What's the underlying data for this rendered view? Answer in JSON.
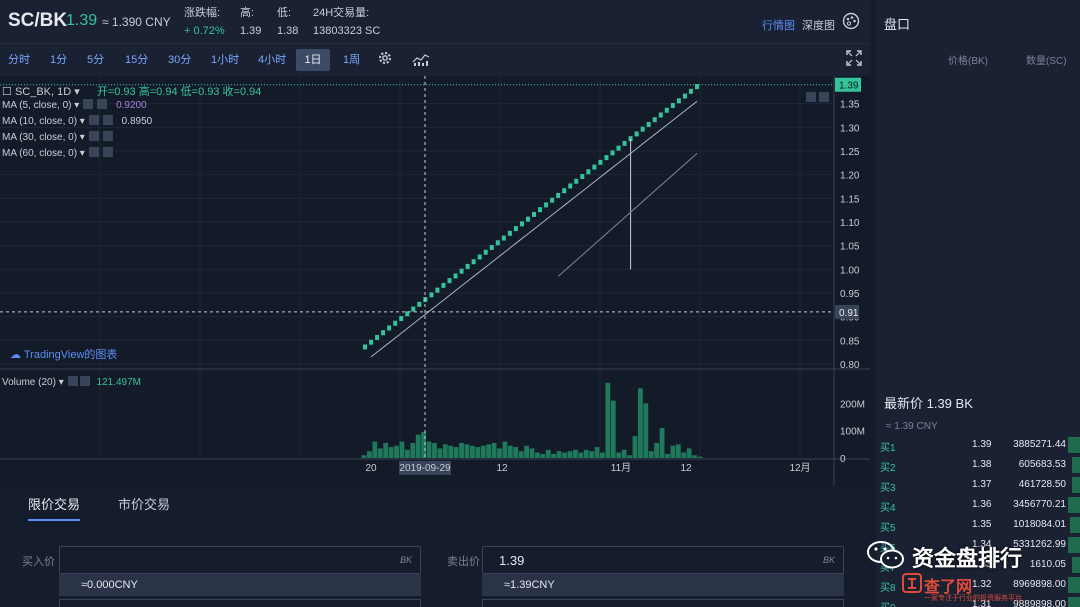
{
  "header": {
    "pair": "SC/BK",
    "price": "1.39",
    "cny": "≈ 1.390 CNY",
    "stats": [
      {
        "key": "涨跌幅:",
        "value": "+ 0.72%"
      },
      {
        "key": "高:",
        "value": "1.39"
      },
      {
        "key": "低:",
        "value": "1.38"
      },
      {
        "key": "24H交易量:",
        "value": "13803323 SC"
      }
    ],
    "tab_line": "行情图",
    "tab_depth": "深度图"
  },
  "toolbar": {
    "timeframes": [
      "分时",
      "1分",
      "5分",
      "15分",
      "30分",
      "1小时",
      "4小时",
      "1日",
      "1周"
    ],
    "active": "1日"
  },
  "chart": {
    "ohlc_symbol": "SC_BK, 1D",
    "ohlc": {
      "open": "开=0.93",
      "high": "高=0.94",
      "low": "低=0.93",
      "close": "收=0.94"
    },
    "ma": [
      {
        "label": "MA (5, close, 0)",
        "value": "0.9200"
      },
      {
        "label": "MA (10, close, 0)",
        "value": "0.8950"
      },
      {
        "label": "MA (30, close, 0)",
        "value": ""
      },
      {
        "label": "MA (60, close, 0)",
        "value": ""
      }
    ],
    "brand": "TradingView的图表",
    "volume_label": "Volume (20)",
    "volume_value": "121.497M",
    "crosshair_x_label": "2019-09-29",
    "crosshair_y_label": "0.91",
    "last_price_tag": "1.39"
  },
  "chart_data": {
    "type": "candlestick",
    "price_axis_ticks": [
      "1.39",
      "1.35",
      "1.30",
      "1.25",
      "1.20",
      "1.15",
      "1.10",
      "1.05",
      "1.00",
      "0.95",
      "0.90",
      "0.85",
      "0.80"
    ],
    "volume_axis_ticks": [
      "200M",
      "100M",
      "0"
    ],
    "x_axis_ticks": [
      "20",
      "2019-09-29",
      "12",
      "11月",
      "12",
      "12月"
    ],
    "closes": [
      0.835,
      0.845,
      0.855,
      0.865,
      0.875,
      0.885,
      0.895,
      0.905,
      0.915,
      0.925,
      0.935,
      0.945,
      0.955,
      0.965,
      0.975,
      0.985,
      0.995,
      1.005,
      1.015,
      1.025,
      1.035,
      1.045,
      1.055,
      1.065,
      1.075,
      1.085,
      1.095,
      1.105,
      1.115,
      1.125,
      1.135,
      1.145,
      1.155,
      1.165,
      1.175,
      1.185,
      1.195,
      1.205,
      1.215,
      1.225,
      1.235,
      1.245,
      1.255,
      1.265,
      1.275,
      1.285,
      1.295,
      1.305,
      1.315,
      1.325,
      1.335,
      1.345,
      1.355,
      1.365,
      1.375,
      1.385
    ],
    "spike_low": 1.0,
    "volumes_m": [
      10,
      25,
      60,
      35,
      55,
      40,
      45,
      60,
      30,
      55,
      85,
      95,
      60,
      55,
      35,
      50,
      45,
      40,
      55,
      50,
      45,
      40,
      45,
      50,
      55,
      35,
      60,
      45,
      40,
      25,
      45,
      35,
      20,
      15,
      30,
      15,
      25,
      20,
      25,
      30,
      20,
      30,
      25,
      40,
      20,
      275,
      210,
      20,
      30,
      10,
      80,
      255,
      200,
      25,
      55,
      110,
      15,
      45,
      50,
      20,
      35,
      10,
      5
    ],
    "series": [
      {
        "name": "MA (5, close, 0)",
        "color": "#a9b4c8"
      },
      {
        "name": "MA (10, close, 0)",
        "color": "#7d8699"
      }
    ]
  },
  "form": {
    "tab_limit": "限价交易",
    "tab_market": "市价交易",
    "buy_label": "买入价",
    "buy_value": "",
    "buy_unit": "BK",
    "buy_hint": "≈0.000CNY",
    "sell_label": "卖出价",
    "sell_value": "1.39",
    "sell_unit": "BK",
    "sell_hint": "≈1.39CNY"
  },
  "panel": {
    "title": "盘口",
    "col_price": "价格(BK)",
    "col_qty": "数量(SC)",
    "last_label": "最新价 1.39 BK",
    "last_sub": "≈ 1.39 CNY",
    "bids": [
      {
        "label": "买1",
        "price": "1.39",
        "qty": "3885271.44",
        "depth": 0.06
      },
      {
        "label": "买2",
        "price": "1.38",
        "qty": "605683.53",
        "depth": 0.04
      },
      {
        "label": "买3",
        "price": "1.37",
        "qty": "461728.50",
        "depth": 0.04
      },
      {
        "label": "买4",
        "price": "1.36",
        "qty": "3456770.21",
        "depth": 0.06
      },
      {
        "label": "买5",
        "price": "1.35",
        "qty": "1018084.01",
        "depth": 0.05
      },
      {
        "label": "买6",
        "price": "1.34",
        "qty": "5331262.99",
        "depth": 0.06
      },
      {
        "label": "买7",
        "price": "1.33",
        "qty": "1610.05",
        "depth": 0.04
      },
      {
        "label": "买8",
        "price": "1.32",
        "qty": "8969898.00",
        "depth": 0.06
      },
      {
        "label": "买9",
        "price": "1.31",
        "qty": "9889898.00",
        "depth": 0.06
      }
    ]
  },
  "watermark": {
    "text": "资金盘排行",
    "badge": "查了网",
    "sub": "一家专注于行业的投资服务平台"
  },
  "colors": {
    "up": "#35c39c",
    "accent": "#5b8ef0",
    "bg": "#131a28"
  }
}
